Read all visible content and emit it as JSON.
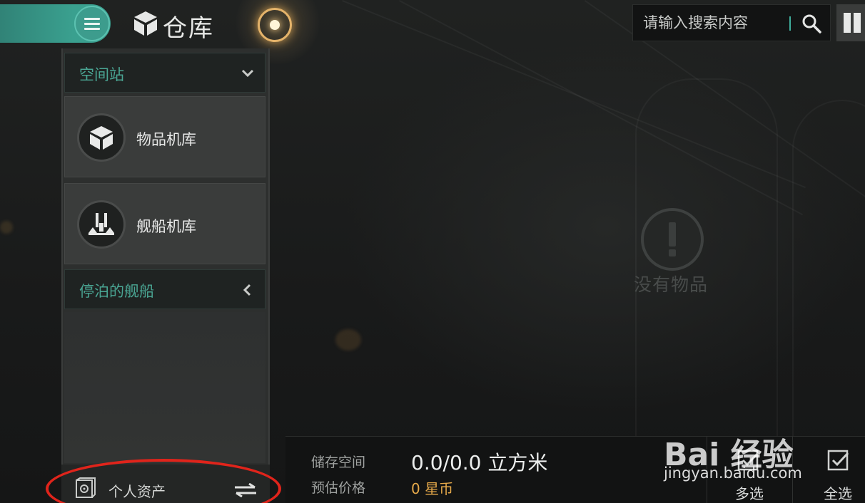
{
  "header": {
    "title": "仓库",
    "search": {
      "placeholder": "请输入搜索内容",
      "value": ""
    }
  },
  "sidebar": {
    "groups": [
      {
        "label": "空间站",
        "state": "expanded",
        "chevron": "chevron-down-icon"
      },
      {
        "label": "停泊的舰船",
        "state": "collapsed",
        "chevron": "chevron-left-icon"
      }
    ],
    "items": [
      {
        "label": "物品机库",
        "icon": "cube-icon"
      },
      {
        "label": "舰船机库",
        "icon": "ship-icon"
      }
    ],
    "assets": {
      "label": "个人资产",
      "icon": "safe-icon",
      "action_icon": "transfer-icon"
    }
  },
  "main": {
    "empty_state": {
      "text": "没有物品",
      "icon": "exclamation-icon"
    }
  },
  "footer": {
    "storage_label": "储存空间",
    "storage_value": "0.0/0.0 立方米",
    "price_label": "预估价格",
    "price_value": "0 星币",
    "multi_select_label": "多选",
    "select_all_label": "全选"
  },
  "watermark": {
    "logo": "Bai 经验",
    "url": "jingyan.baidu.com"
  },
  "colors": {
    "accent_teal": "#3aa08f",
    "price_gold": "#e6a94a",
    "annotation_red": "#e0241b"
  }
}
